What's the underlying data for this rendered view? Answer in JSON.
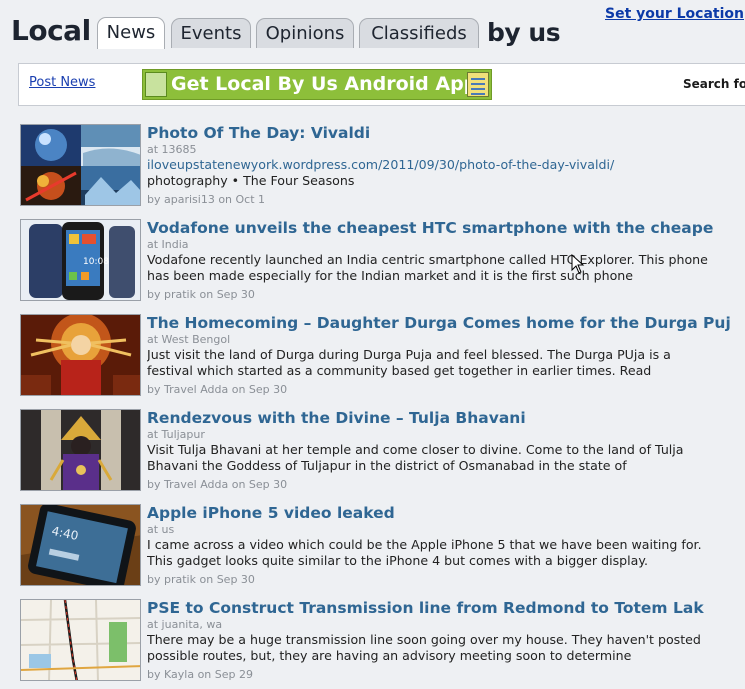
{
  "header": {
    "logo_left": "Local",
    "logo_right": "by us",
    "tabs": [
      {
        "label": "News",
        "active": true
      },
      {
        "label": "Events",
        "active": false
      },
      {
        "label": "Opinions",
        "active": false
      },
      {
        "label": "Classifieds",
        "active": false
      }
    ],
    "set_location": "Set your Location"
  },
  "toolbar": {
    "post_news": "Post News",
    "app_button": "Get Local By Us Android App",
    "search_label": "Search for"
  },
  "colors": {
    "link": "#2f6693",
    "accent_green": "#8dbf3a",
    "meta_gray": "#8a8f96"
  },
  "feed": [
    {
      "title": "Photo Of The Day: Vivaldi",
      "location": "at 13685",
      "url": "iloveupstatenewyork.wordpress.com/2011/09/30/photo-of-the-day-vivaldi/",
      "description": "photography • The Four Seasons",
      "author": "aparisi13",
      "date": "on Oct 1",
      "thumb": "vivaldi-collage-image"
    },
    {
      "title": "Vodafone unveils the cheapest HTC smartphone with the cheape",
      "location": "at India",
      "url": "",
      "description": "Vodafone recently launched an India centric smartphone called HTC Explorer. This phone has been made especially for the Indian market and it is the first such phone",
      "author": "pratik",
      "date": "on Sep 30",
      "thumb": "htc-phone-image"
    },
    {
      "title": "The Homecoming – Daughter Durga Comes home for the Durga Puj",
      "location": "at West Bengol",
      "url": "",
      "description": "Just visit the land of Durga during Durga Puja and feel blessed. The Durga PUja is a festival which started as a community based get together in earlier times. Read",
      "author": "Travel Adda",
      "date": "on Sep 30",
      "thumb": "durga-idol-image"
    },
    {
      "title": "Rendezvous with the Divine – Tulja Bhavani",
      "location": "at Tuljapur",
      "url": "",
      "description": "Visit Tulja Bhavani at her temple and come closer to divine. Come to the land of Tulja Bhavani the Goddess of Tuljapur in the district of Osmanabad in the state of",
      "author": "Travel Adda",
      "date": "on Sep 30",
      "thumb": "tulja-bhavani-image"
    },
    {
      "title": "Apple iPhone 5 video leaked",
      "location": "at us",
      "url": "",
      "description": "I came across a video which could be the Apple iPhone 5 that we have been waiting for. This gadget looks quite similar to the iPhone 4 but comes with a bigger display.",
      "author": "pratik",
      "date": "on Sep 30",
      "thumb": "iphone-image"
    },
    {
      "title": "PSE to Construct Transmission line from Redmond to Totem Lak",
      "location": "at juanita, wa",
      "url": "",
      "description": "There may be a huge transmission line soon going over my house. They haven't posted possible routes, but, they are having an advisory meeting soon to determine",
      "author": "Kayla",
      "date": "on Sep 29",
      "thumb": "map-image"
    }
  ]
}
